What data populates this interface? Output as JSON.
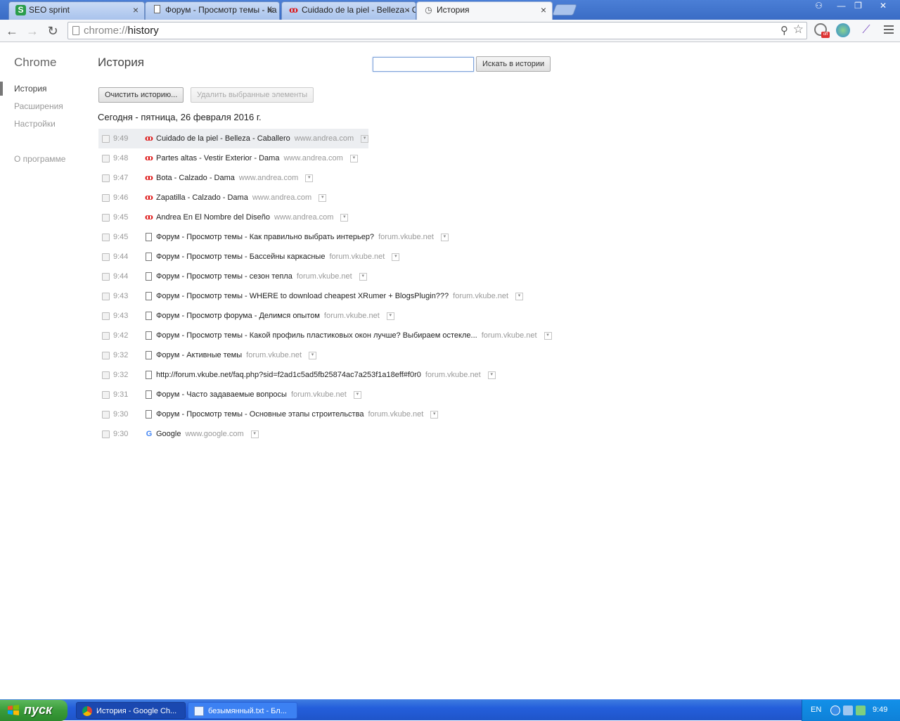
{
  "browser": {
    "tabs": [
      {
        "title": "SEO sprint",
        "icon": "seosprint-icon"
      },
      {
        "title": "Форум - Просмотр темы - Ка",
        "icon": "page-icon"
      },
      {
        "title": "Cuidado de la piel - Belleza - C",
        "icon": "andrea-icon"
      },
      {
        "title": "История",
        "icon": "history-icon"
      }
    ],
    "url_scheme": "chrome://",
    "url_path": "history",
    "window_buttons": {
      "minimize": "—",
      "restore": "❐",
      "close": "✕"
    }
  },
  "sidebar": {
    "brand": "Chrome",
    "items": [
      {
        "label": "История"
      },
      {
        "label": "Расширения"
      },
      {
        "label": "Настройки"
      },
      {
        "label": "О программе"
      }
    ]
  },
  "main": {
    "title": "История",
    "search_button": "Искать в истории",
    "search_value": "",
    "clear_button": "Очистить историю...",
    "remove_button": "Удалить выбранные элементы",
    "day_header": "Сегодня - пятница, 26 февраля 2016 г.",
    "entries": [
      {
        "time": "9:49",
        "favicon": "andrea",
        "title": "Cuidado de la piel - Belleza - Caballero",
        "domain": "www.andrea.com"
      },
      {
        "time": "9:48",
        "favicon": "andrea",
        "title": "Partes altas - Vestir Exterior - Dama",
        "domain": "www.andrea.com"
      },
      {
        "time": "9:47",
        "favicon": "andrea",
        "title": "Bota - Calzado - Dama",
        "domain": "www.andrea.com"
      },
      {
        "time": "9:46",
        "favicon": "andrea",
        "title": "Zapatilla - Calzado - Dama",
        "domain": "www.andrea.com"
      },
      {
        "time": "9:45",
        "favicon": "andrea",
        "title": "Andrea En El Nombre del Diseño",
        "domain": "www.andrea.com"
      },
      {
        "time": "9:45",
        "favicon": "page",
        "title": "Форум - Просмотр темы - Как правильно выбрать интерьер?",
        "domain": "forum.vkube.net"
      },
      {
        "time": "9:44",
        "favicon": "page",
        "title": "Форум - Просмотр темы - Бассейны каркасные",
        "domain": "forum.vkube.net"
      },
      {
        "time": "9:44",
        "favicon": "page",
        "title": "Форум - Просмотр темы - сезон тепла",
        "domain": "forum.vkube.net"
      },
      {
        "time": "9:43",
        "favicon": "page",
        "title": "Форум - Просмотр темы - WHERE to download cheapest XRumer + BlogsPlugin???",
        "domain": "forum.vkube.net"
      },
      {
        "time": "9:43",
        "favicon": "page",
        "title": "Форум - Просмотр форума - Делимся опытом",
        "domain": "forum.vkube.net"
      },
      {
        "time": "9:42",
        "favicon": "page",
        "title": "Форум - Просмотр темы - Какой профиль пластиковых окон лучше? Выбираем остекле...",
        "domain": "forum.vkube.net"
      },
      {
        "time": "9:32",
        "favicon": "page",
        "title": "Форум - Активные темы",
        "domain": "forum.vkube.net"
      },
      {
        "time": "9:32",
        "favicon": "page",
        "title": "http://forum.vkube.net/faq.php?sid=f2ad1c5ad5fb25874ac7a253f1a18eff#f0r0",
        "domain": "forum.vkube.net"
      },
      {
        "time": "9:31",
        "favicon": "page",
        "title": "Форум - Часто задаваемые вопросы",
        "domain": "forum.vkube.net"
      },
      {
        "time": "9:30",
        "favicon": "page",
        "title": "Форум - Просмотр темы - Основные этапы строительства",
        "domain": "forum.vkube.net"
      },
      {
        "time": "9:30",
        "favicon": "google",
        "title": "Google",
        "domain": "www.google.com"
      }
    ]
  },
  "taskbar": {
    "start_label": "пуск",
    "items": [
      {
        "label": "История - Google Ch..."
      },
      {
        "label": "безымянный.txt - Бл..."
      }
    ],
    "lang": "EN",
    "clock": "9:49"
  },
  "colors": {
    "accent": "#3a6cc5",
    "taskbar": "#245edb",
    "start": "#3a9b3a"
  }
}
